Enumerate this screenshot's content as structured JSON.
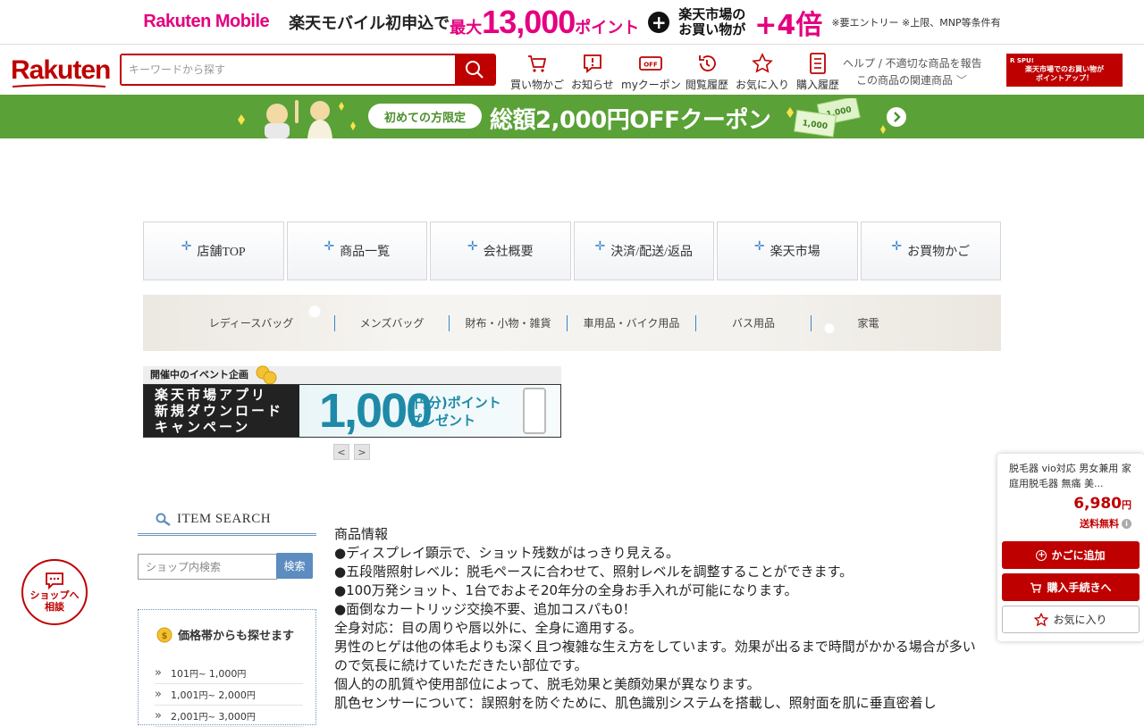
{
  "promo": {
    "brand": "Rakuten Mobile",
    "text1": "楽天モバイル初申込で",
    "max": "最大",
    "amount": "13,000",
    "points": "ポイント",
    "plus": "+",
    "line_a": "楽天市場の",
    "line_b": "お買い物が",
    "multiplier": "+4倍",
    "note": "※要エントリー ※上限、MNP等条件有"
  },
  "header": {
    "logo": "Rakuten",
    "search_placeholder": "キーワードから探す",
    "nav": [
      {
        "label": "買い物かご",
        "icon": "cart-icon"
      },
      {
        "label": "お知らせ",
        "icon": "notice-icon"
      },
      {
        "label": "myクーポン",
        "icon": "coupon-icon"
      },
      {
        "label": "閲覧履歴",
        "icon": "history-icon"
      },
      {
        "label": "お気に入り",
        "icon": "star-icon"
      },
      {
        "label": "購入履歴",
        "icon": "purchase-history-icon"
      }
    ],
    "help_link": "ヘルプ / 不適切な商品を報告",
    "related_link": "この商品の関連商品",
    "spu_logo": "R SPU!",
    "spu_line1": "楽天市場でのお買い物が",
    "spu_line2": "ポイントアップ！"
  },
  "coupon_banner": {
    "pill": "初めての方限定",
    "text": "総額2,000円OFFクーポン",
    "bill1": "1,000",
    "bill2": "1,000"
  },
  "shop_nav": [
    "店舗TOP",
    "商品一覧",
    "会社概要",
    "決済/配送/返品",
    "楽天市場",
    "お買物かご"
  ],
  "categories": [
    "レディースバッグ",
    "メンズバッグ",
    "財布・小物・雑貨",
    "車用品・バイク用品",
    "バス用品",
    "家電"
  ],
  "event": {
    "heading": "開催中のイベント企画",
    "left_lines": [
      "楽天市場アプリ",
      "新規ダウンロード",
      "キャンペーン"
    ],
    "amount": "1,000",
    "sub1": "(円分)ポイント",
    "sub2": "プレゼント",
    "prev": "<",
    "next": ">"
  },
  "sidebar": {
    "item_search": "ITEM SEARCH",
    "shop_search_placeholder": "ショップ内検索",
    "search_button": "検索",
    "price_title": "価格帯からも探せます",
    "price_ranges": [
      {
        "from": "101",
        "to": "1,000"
      },
      {
        "from": "1,001",
        "to": "2,000"
      },
      {
        "from": "2,001",
        "to": "3,000"
      }
    ],
    "yen_from": "円~",
    "yen": "円"
  },
  "chat": {
    "line1": "ショップへ",
    "line2": "相談"
  },
  "description": [
    "商品情報",
    "●ディスプレイ顕示で、ショット残数がはっきり見える。",
    "●五段階照射レベル：脱毛ペースに合わせて、照射レベルを調整することができます。",
    "●100万発ショット、1台でおよそ20年分の全身お手入れが可能になります。",
    "●面倒なカートリッジ交換不要、追加コスパも0！",
    "全身対応：目の周りや唇以外に、全身に適用する。",
    "男性のヒゲは他の体毛よりも深く且つ複雑な生え方をしています。効果が出るまで時間がかかる場合が多いので気長に続けていただきたい部位です。",
    "個人的の肌質や使用部位によって、脱毛効果と美顔効果が異なります。",
    "肌色センサーについて：誤照射を防ぐために、肌色識別システムを搭載し、照射面を肌に垂直密着し"
  ],
  "cart_panel": {
    "product_name": "脱毛器 vio対応 男女兼用 家庭用脱毛器 無痛 美...",
    "price": "6,980",
    "price_unit": "円",
    "shipping": "送料無料",
    "add_to_cart": "かごに追加",
    "buy_now": "購入手続きへ",
    "favorite": "お気に入り"
  },
  "colors": {
    "rakuten_red": "#bf0000",
    "mobile_pink": "#e4007f",
    "coupon_green": "#5aa137",
    "shop_blue": "#3b84c6"
  }
}
